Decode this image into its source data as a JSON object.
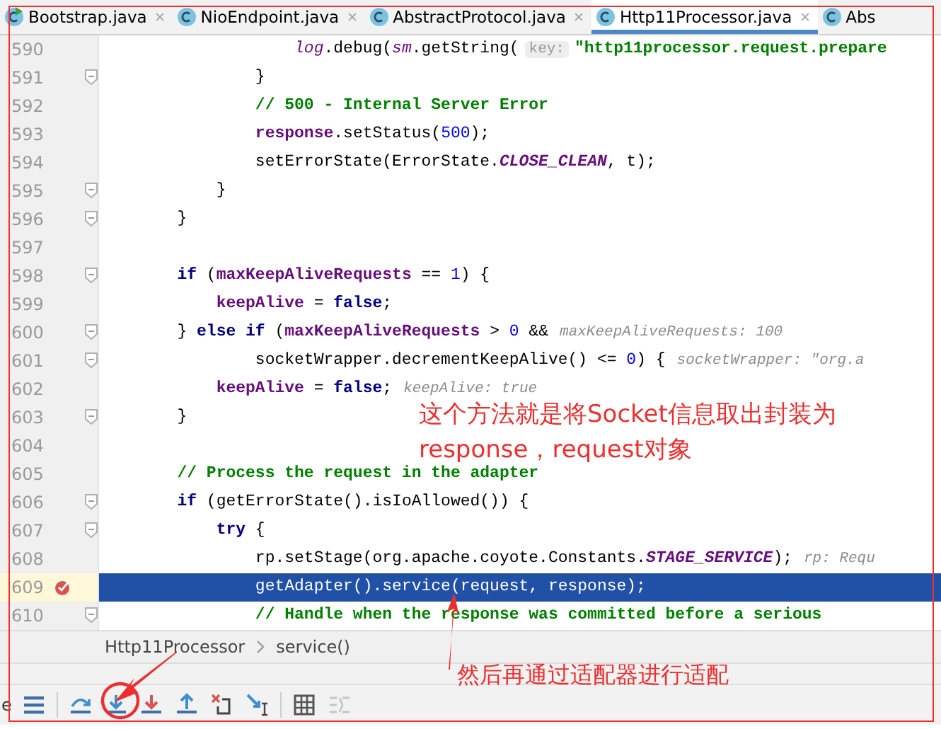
{
  "tabs": [
    {
      "label": "Bootstrap.java",
      "selected": false,
      "closable": true,
      "running": true
    },
    {
      "label": "NioEndpoint.java",
      "selected": false,
      "closable": true,
      "running": false
    },
    {
      "label": "AbstractProtocol.java",
      "selected": false,
      "closable": true,
      "running": false
    },
    {
      "label": "Http11Processor.java",
      "selected": true,
      "closable": true,
      "running": false
    },
    {
      "label": "Abs",
      "selected": false,
      "closable": false,
      "running": false
    }
  ],
  "lines": [
    {
      "number": "590",
      "selected": false,
      "breakpoint": false,
      "fold": false,
      "tokens": [
        {
          "kind": "static",
          "text": "                    log"
        },
        {
          "kind": "plain",
          "text": ".debug("
        },
        {
          "kind": "static",
          "text": "sm"
        },
        {
          "kind": "plain",
          "text": ".getString("
        },
        {
          "kind": "param",
          "text": "key:"
        },
        {
          "kind": "string",
          "text": "\"http11processor.request.prepare"
        }
      ]
    },
    {
      "number": "591",
      "selected": false,
      "breakpoint": false,
      "fold": true,
      "tokens": [
        {
          "kind": "plain",
          "text": "                }"
        }
      ]
    },
    {
      "number": "592",
      "selected": false,
      "breakpoint": false,
      "fold": false,
      "tokens": [
        {
          "kind": "comment",
          "text": "                // 500 - Internal Server Error"
        }
      ]
    },
    {
      "number": "593",
      "selected": false,
      "breakpoint": false,
      "fold": false,
      "tokens": [
        {
          "kind": "field",
          "text": "                response"
        },
        {
          "kind": "plain",
          "text": ".setStatus("
        },
        {
          "kind": "number",
          "text": "500"
        },
        {
          "kind": "plain",
          "text": ");"
        }
      ]
    },
    {
      "number": "594",
      "selected": false,
      "breakpoint": false,
      "fold": false,
      "tokens": [
        {
          "kind": "plain",
          "text": "                setErrorState(ErrorState."
        },
        {
          "kind": "constant",
          "text": "CLOSE_CLEAN"
        },
        {
          "kind": "plain",
          "text": ", t);"
        }
      ]
    },
    {
      "number": "595",
      "selected": false,
      "breakpoint": false,
      "fold": true,
      "tokens": [
        {
          "kind": "plain",
          "text": "            }"
        }
      ]
    },
    {
      "number": "596",
      "selected": false,
      "breakpoint": false,
      "fold": true,
      "tokens": [
        {
          "kind": "plain",
          "text": "        }"
        }
      ]
    },
    {
      "number": "597",
      "selected": false,
      "breakpoint": false,
      "fold": false
    },
    {
      "number": "598",
      "selected": false,
      "breakpoint": false,
      "fold": true,
      "tokens": [
        {
          "kind": "keyword",
          "text": "        if"
        },
        {
          "kind": "plain",
          "text": " ("
        },
        {
          "kind": "field",
          "text": "maxKeepAliveRequests"
        },
        {
          "kind": "plain",
          "text": " == "
        },
        {
          "kind": "number",
          "text": "1"
        },
        {
          "kind": "plain",
          "text": ") {"
        }
      ]
    },
    {
      "number": "599",
      "selected": false,
      "breakpoint": false,
      "fold": false,
      "tokens": [
        {
          "kind": "field",
          "text": "            keepAlive"
        },
        {
          "kind": "plain",
          "text": " = "
        },
        {
          "kind": "keyword",
          "text": "false"
        },
        {
          "kind": "plain",
          "text": ";"
        }
      ]
    },
    {
      "number": "600",
      "selected": false,
      "breakpoint": false,
      "fold": true,
      "tokens": [
        {
          "kind": "plain",
          "text": "        } "
        },
        {
          "kind": "keyword",
          "text": "else if"
        },
        {
          "kind": "plain",
          "text": " ("
        },
        {
          "kind": "field",
          "text": "maxKeepAliveRequests"
        },
        {
          "kind": "plain",
          "text": " > "
        },
        {
          "kind": "number",
          "text": "0"
        },
        {
          "kind": "plain",
          "text": " &&"
        },
        {
          "kind": "hint",
          "text": "maxKeepAliveRequests: 100"
        }
      ]
    },
    {
      "number": "601",
      "selected": false,
      "breakpoint": false,
      "fold": true,
      "tokens": [
        {
          "kind": "plain",
          "text": "                socketWrapper.decrementKeepAlive() <= "
        },
        {
          "kind": "number",
          "text": "0"
        },
        {
          "kind": "plain",
          "text": ") {"
        },
        {
          "kind": "hint",
          "text": "socketWrapper: \"org.a"
        }
      ]
    },
    {
      "number": "602",
      "selected": false,
      "breakpoint": false,
      "fold": false,
      "tokens": [
        {
          "kind": "field",
          "text": "            keepAlive"
        },
        {
          "kind": "plain",
          "text": " = "
        },
        {
          "kind": "keyword",
          "text": "false"
        },
        {
          "kind": "plain",
          "text": ";"
        },
        {
          "kind": "hint",
          "text": "keepAlive: true"
        }
      ]
    },
    {
      "number": "603",
      "selected": false,
      "breakpoint": false,
      "fold": true,
      "tokens": [
        {
          "kind": "plain",
          "text": "        }"
        }
      ]
    },
    {
      "number": "604",
      "selected": false,
      "breakpoint": false,
      "fold": false
    },
    {
      "number": "605",
      "selected": false,
      "breakpoint": false,
      "fold": false,
      "tokens": [
        {
          "kind": "comment",
          "text": "        // Process the request in the adapter"
        }
      ]
    },
    {
      "number": "606",
      "selected": false,
      "breakpoint": false,
      "fold": true,
      "tokens": [
        {
          "kind": "keyword",
          "text": "        if"
        },
        {
          "kind": "plain",
          "text": " (getErrorState().isIoAllowed()) {"
        }
      ]
    },
    {
      "number": "607",
      "selected": false,
      "breakpoint": false,
      "fold": true,
      "tokens": [
        {
          "kind": "keyword",
          "text": "            try"
        },
        {
          "kind": "plain",
          "text": " {"
        }
      ]
    },
    {
      "number": "608",
      "selected": false,
      "breakpoint": false,
      "fold": false,
      "tokens": [
        {
          "kind": "plain",
          "text": "                rp.setStage(org.apache.coyote.Constants."
        },
        {
          "kind": "constant",
          "text": "STAGE_SERVICE"
        },
        {
          "kind": "plain",
          "text": ");"
        },
        {
          "kind": "hint",
          "text": "rp: Requ"
        }
      ]
    },
    {
      "number": "609",
      "selected": true,
      "breakpoint": true,
      "fold": false,
      "tokens": [
        {
          "kind": "plain",
          "text": "                getAdapter().service(request, response);"
        }
      ]
    },
    {
      "number": "610",
      "selected": false,
      "breakpoint": false,
      "fold": true,
      "tokens": [
        {
          "kind": "comment",
          "text": "                // Handle when the response was committed before a serious"
        }
      ]
    }
  ],
  "breadcrumb": [
    "Http11Processor",
    "service()"
  ],
  "toolbar": {
    "edge_text": "e",
    "buttons": [
      {
        "kind": "frames",
        "disabled": false
      },
      {
        "kind": "step-over",
        "disabled": false
      },
      {
        "kind": "step-into",
        "disabled": false
      },
      {
        "kind": "force-step-into",
        "disabled": false
      },
      {
        "kind": "step-out",
        "disabled": false
      },
      {
        "kind": "drop-frame",
        "disabled": false
      },
      {
        "kind": "run-to-cursor",
        "disabled": false
      },
      {
        "kind": "evaluate",
        "disabled": false
      },
      {
        "kind": "trace",
        "disabled": true
      }
    ]
  },
  "annotations": [
    {
      "lines": [
        "这个方法就是将Socket信息取出封装为",
        "response，request对象"
      ]
    },
    {
      "lines": [
        "然后再通过适配器进行适配"
      ]
    }
  ]
}
